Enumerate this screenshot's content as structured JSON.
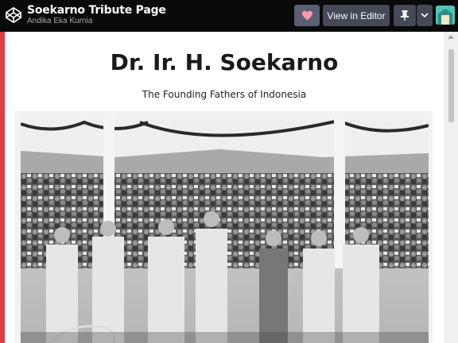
{
  "header": {
    "title": "Soekarno Tribute Page",
    "author": "Andika Eka Kurnia",
    "view_in_editor_label": "View in Editor"
  },
  "icons": {
    "logo": "codepen-logo-icon",
    "like": "heart-icon",
    "pin": "pin-icon",
    "more": "chevron-down-icon"
  },
  "colors": {
    "accent_red": "#e03c44",
    "heart_pink": "#f49aa8"
  },
  "main": {
    "heading": "Dr. Ir. H. Soekarno",
    "subheading": "The Founding Fathers of Indonesia"
  }
}
